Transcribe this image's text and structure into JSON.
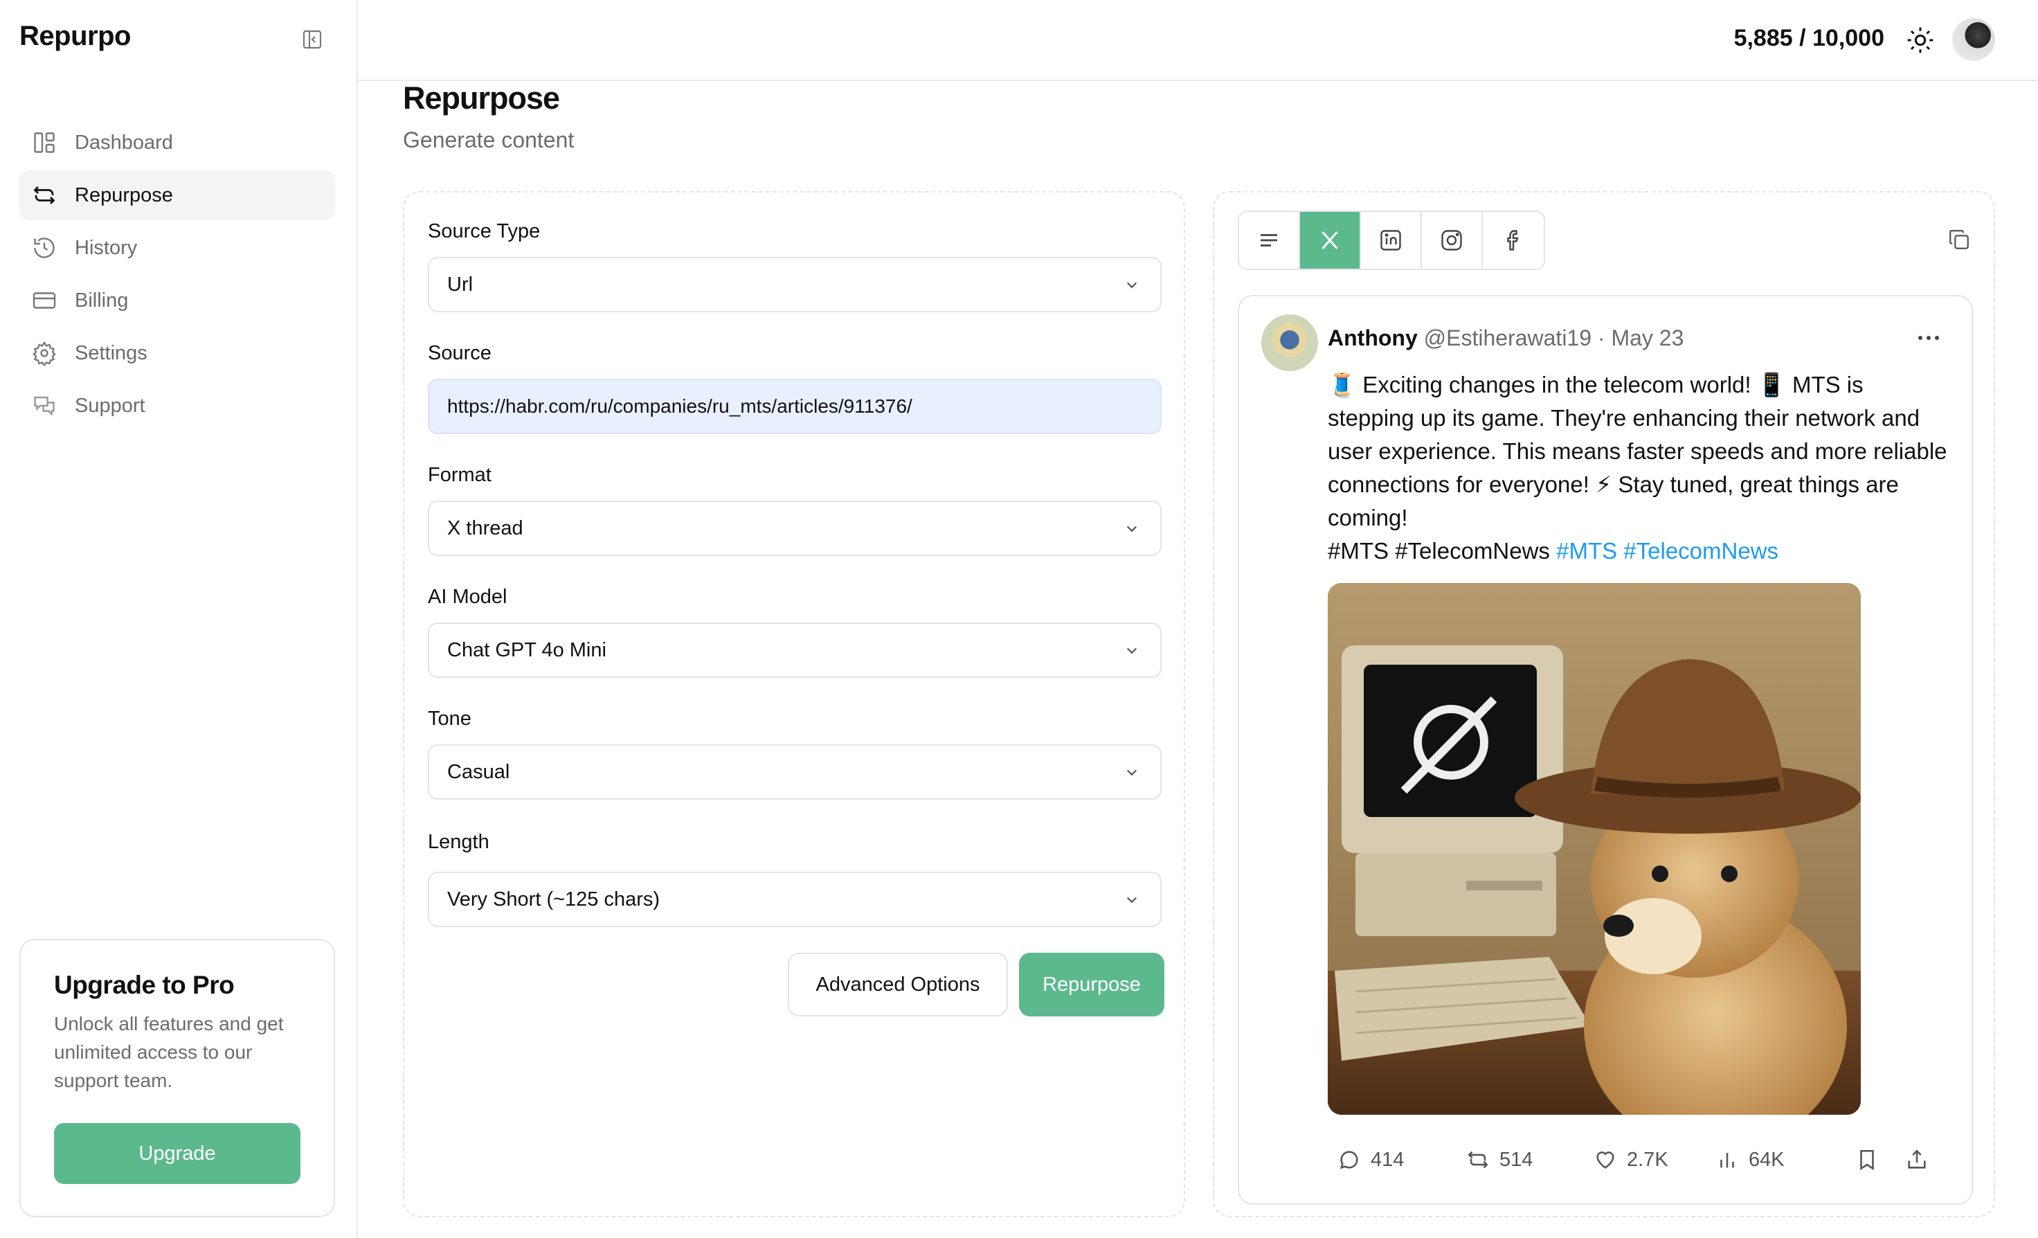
{
  "app": {
    "name": "Repurpo"
  },
  "sidebar": {
    "items": [
      {
        "label": "Dashboard",
        "icon": "dashboard-icon",
        "active": false
      },
      {
        "label": "Repurpose",
        "icon": "repeat-icon",
        "active": true
      },
      {
        "label": "History",
        "icon": "history-icon",
        "active": false
      },
      {
        "label": "Billing",
        "icon": "credit-card-icon",
        "active": false
      },
      {
        "label": "Settings",
        "icon": "gear-icon",
        "active": false
      },
      {
        "label": "Support",
        "icon": "chat-icon",
        "active": false
      }
    ],
    "upgrade": {
      "title": "Upgrade to Pro",
      "text": "Unlock all features and get unlimited access to our support team.",
      "button": "Upgrade"
    }
  },
  "topbar": {
    "credits": "5,885 / 10,000"
  },
  "page": {
    "title": "Repurpose",
    "subtitle": "Generate content"
  },
  "form": {
    "source_type": {
      "label": "Source Type",
      "value": "Url"
    },
    "source": {
      "label": "Source",
      "value": "https://habr.com/ru/companies/ru_mts/articles/911376/"
    },
    "format": {
      "label": "Format",
      "value": "X thread"
    },
    "ai_model": {
      "label": "AI Model",
      "value": "Chat GPT 4o Mini"
    },
    "tone": {
      "label": "Tone",
      "value": "Casual"
    },
    "length": {
      "label": "Length",
      "value": "Very Short (~125 chars)"
    },
    "advanced_label": "Advanced Options",
    "submit_label": "Repurpose"
  },
  "preview": {
    "tabs": [
      "text-icon",
      "x-icon",
      "linkedin-icon",
      "instagram-icon",
      "facebook-icon"
    ],
    "active_tab": "x-icon",
    "accent_color": "#5cb98e",
    "tweet": {
      "name": "Anthony",
      "handle": "@Estiherawati19",
      "date": "· May 23",
      "body": "🧵 Exciting changes in the telecom world! 📱 MTS is stepping up its game. They're enhancing their network and user experience. This means faster speeds and more reliable connections for everyone! ⚡ Stay tuned, great things are coming!",
      "tags": "#MTS #TelecomNews",
      "links": "#MTS #TelecomNews",
      "link_color": "#1d9bf0",
      "stats": {
        "replies": "414",
        "retweets": "514",
        "likes": "2.7K",
        "views": "64K"
      }
    }
  }
}
